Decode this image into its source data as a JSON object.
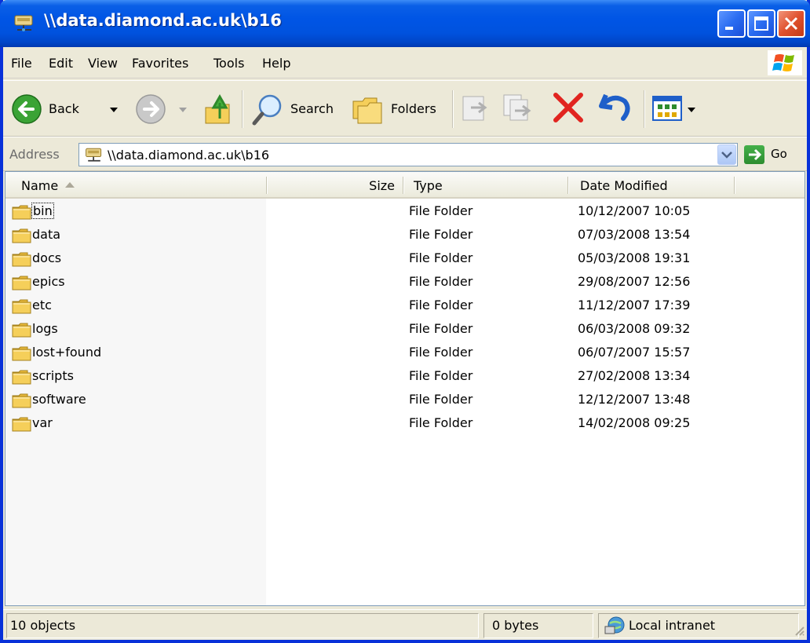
{
  "window": {
    "title": "\\\\data.diamond.ac.uk\\b16"
  },
  "menu": [
    "File",
    "Edit",
    "View",
    "Favorites",
    "Tools",
    "Help"
  ],
  "toolbar": {
    "back_label": "Back",
    "search_label": "Search",
    "folders_label": "Folders"
  },
  "address": {
    "label": "Address",
    "value": "\\\\data.diamond.ac.uk\\b16",
    "go_label": "Go"
  },
  "columns": {
    "name": "Name",
    "size": "Size",
    "type": "Type",
    "date": "Date Modified"
  },
  "files": [
    {
      "name": "bin",
      "size": "",
      "type": "File Folder",
      "date": "10/12/2007 10:05"
    },
    {
      "name": "data",
      "size": "",
      "type": "File Folder",
      "date": "07/03/2008 13:54"
    },
    {
      "name": "docs",
      "size": "",
      "type": "File Folder",
      "date": "05/03/2008 19:31"
    },
    {
      "name": "epics",
      "size": "",
      "type": "File Folder",
      "date": "29/08/2007 12:56"
    },
    {
      "name": "etc",
      "size": "",
      "type": "File Folder",
      "date": "11/12/2007 17:39"
    },
    {
      "name": "logs",
      "size": "",
      "type": "File Folder",
      "date": "06/03/2008 09:32"
    },
    {
      "name": "lost+found",
      "size": "",
      "type": "File Folder",
      "date": "06/07/2007 15:57"
    },
    {
      "name": "scripts",
      "size": "",
      "type": "File Folder",
      "date": "27/02/2008 13:34"
    },
    {
      "name": "software",
      "size": "",
      "type": "File Folder",
      "date": "12/12/2007 13:48"
    },
    {
      "name": "var",
      "size": "",
      "type": "File Folder",
      "date": "14/02/2008 09:25"
    }
  ],
  "status": {
    "objects": "10 objects",
    "size": "0 bytes",
    "zone": "Local intranet"
  },
  "icons": {
    "window": "network-drive-icon",
    "folder": "folder-icon",
    "zone": "local-intranet-icon"
  },
  "colors": {
    "titlebar": "#0055e5",
    "frame": "#0831d9",
    "chrome": "#ece9d8",
    "close": "#e0522e",
    "folder": "#f5cf5a"
  }
}
